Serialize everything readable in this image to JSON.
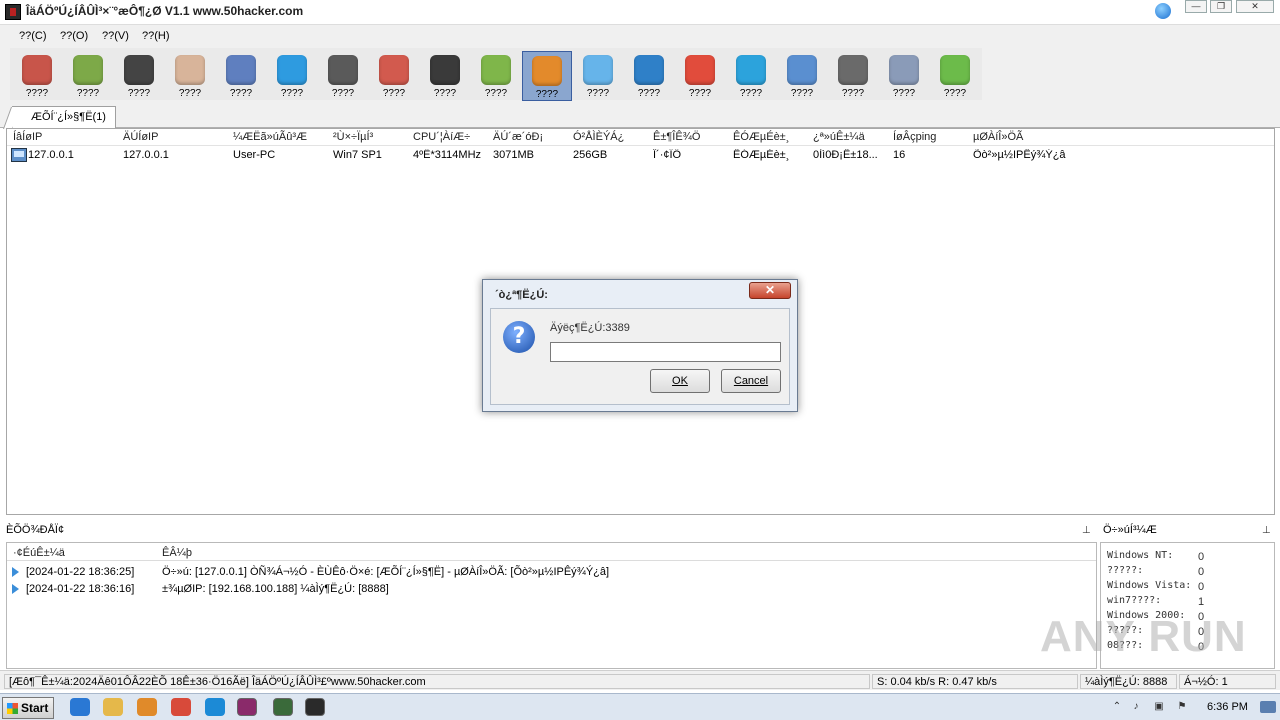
{
  "window": {
    "title": "ÎäÁÖºÚ¿ÍÂÛÌ³×¨°æÔ¶¿Ø V1.1 www.50hacker.com",
    "min_label": "—",
    "max_label": "❐",
    "close_label": "✕"
  },
  "menu": [
    "??(C)",
    "??(O)",
    "??(V)",
    "??(H)"
  ],
  "toolbar": {
    "items": [
      {
        "label": "????",
        "icon": "font-icon",
        "color": "#c8554a"
      },
      {
        "label": "????",
        "icon": "disk-icon",
        "color": "#7da948"
      },
      {
        "label": "????",
        "icon": "terminal-icon",
        "color": "#444444"
      },
      {
        "label": "????",
        "icon": "keypad-icon",
        "color": "#d8b49a"
      },
      {
        "label": "????",
        "icon": "monitor-graph-icon",
        "color": "#5f7fbf"
      },
      {
        "label": "????",
        "icon": "app-store-icon",
        "color": "#2e9be0"
      },
      {
        "label": "????",
        "icon": "camera-icon",
        "color": "#5a5a5a"
      },
      {
        "label": "????",
        "icon": "microphone-icon",
        "color": "#d25a4e"
      },
      {
        "label": "????",
        "icon": "clock-icon",
        "color": "#3a3a3a"
      },
      {
        "label": "????",
        "icon": "download-icon",
        "color": "#7fb64a"
      },
      {
        "label": "????",
        "icon": "star-icon",
        "color": "#e38a2b"
      },
      {
        "label": "????",
        "icon": "cloud-icon",
        "color": "#66b4ea"
      },
      {
        "label": "????",
        "icon": "chat-icon",
        "color": "#2f80c8"
      },
      {
        "label": "????",
        "icon": "calendar-icon",
        "color": "#e14c3c"
      },
      {
        "label": "????",
        "icon": "skype-icon",
        "color": "#2ca3dc"
      },
      {
        "label": "????",
        "icon": "globe-icon",
        "color": "#5a8fd0"
      },
      {
        "label": "????",
        "icon": "settings-gear-icon",
        "color": "#6a6a6a"
      },
      {
        "label": "????",
        "icon": "checklist-icon",
        "color": "#8a9bb8"
      },
      {
        "label": "????",
        "icon": "phone-icon",
        "color": "#6cbb4a"
      }
    ],
    "selected_index": 10
  },
  "tab": {
    "label": "ÆÕÍ¨¿Í»§¶Ë(1)"
  },
  "hosts": {
    "columns": [
      "ÍâÍøIP",
      "ÄÚÍøIP",
      "¼ÆËã»úÃû³Æ",
      "²Ù×÷ÏµÍ³",
      "CPU´¦ÀíÆ÷",
      "ÄÚ´æ´óÐ¡",
      "Ó²ÅÌÈÝÁ¿",
      "Ê±¶ÎÊ¾Ö",
      "ÊÓÆµÉè±¸",
      "¿ª»úÊ±¼ä",
      "ÍøÂçping",
      "µØÀíÎ»ÖÃ"
    ],
    "rows": [
      [
        "127.0.0.1",
        "127.0.0.1",
        "User-PC",
        "Win7 SP1",
        "4ºË*3114MHz",
        "3071MB",
        "256GB",
        "Î´·¢ÏÖ",
        "ÊÓÆµÉè±¸",
        "0Ìì0Ð¡Ê±18...",
        "16",
        "Õò²»µ½IPÊý¾Ý¿â"
      ]
    ]
  },
  "dialog": {
    "title": "´ò¿ª¶Ë¿Ú:",
    "close_label": "✕",
    "prompt": "Äýëç¶Ë¿Ú:3389",
    "input_value": "",
    "ok_label": "OK",
    "cancel_label": "Cancel"
  },
  "log": {
    "title": "ÈÕÖ¾ÐÅÏ¢",
    "col_time": "·¢ÉúÊ±¼ä",
    "col_event": "ÊÂ¼þ",
    "rows": [
      {
        "time": "[2024-01-22 18:36:25]",
        "msg": "Ö÷»ú: [127.0.0.1] ÒÑ¾­Á¬½Ó - ÈÙÊô·Ö×é: [ÆÕÍ¨¿Í»§¶Ë] - µØÀíÎ»ÖÃ: [Õò²»µ½IPÊý¾Ý¿â]"
      },
      {
        "time": "[2024-01-22 18:36:16]",
        "msg": "±¾µØIP: [192.168.100.188] ¼àÌý¶Ë¿Ú: [8888]"
      }
    ]
  },
  "stats": {
    "title": "Ö÷»úÍ³¼Æ",
    "rows": [
      {
        "k": "Windows NT:",
        "v": "0"
      },
      {
        "k": "?????:",
        "v": "0"
      },
      {
        "k": "Windows Vista:",
        "v": "0"
      },
      {
        "k": "win7????:",
        "v": "1"
      },
      {
        "k": "Windows 2000:",
        "v": "0"
      },
      {
        "k": "?????:",
        "v": "0"
      },
      {
        "k": "08???:",
        "v": "0"
      }
    ]
  },
  "watermark": "ANY RUN",
  "statusbar": {
    "left": "[Æô¶¯Ê±¼ä:2024Äê01ÔÂ22ÈÕ 18Ê±36·Ö16Ãë]   ÎäÁÖºÚ¿ÍÂÛÌ³£ºwww.50hacker.com",
    "speed": "S: 0.04 kb/s R: 0.47 kb/s",
    "port": "¼àÌý¶Ë¿Ú: 8888",
    "online": "Á¬½Ó: 1"
  },
  "taskbar": {
    "start_label": "Start",
    "time": "6:36 PM",
    "apps": [
      {
        "icon": "ie-icon",
        "color": "#2a78d4"
      },
      {
        "icon": "folder-icon",
        "color": "#e5b84a"
      },
      {
        "icon": "media-player-icon",
        "color": "#e08a2a"
      },
      {
        "icon": "chrome-icon",
        "color": "#d84a3a"
      },
      {
        "icon": "edge-icon",
        "color": "#1c8ad6"
      },
      {
        "icon": "winrar-icon",
        "color": "#8a2a6a"
      },
      {
        "icon": "network-app-icon",
        "color": "#3a6a3a"
      },
      {
        "icon": "remote-control-app-icon",
        "color": "#2a2a2a"
      }
    ]
  }
}
